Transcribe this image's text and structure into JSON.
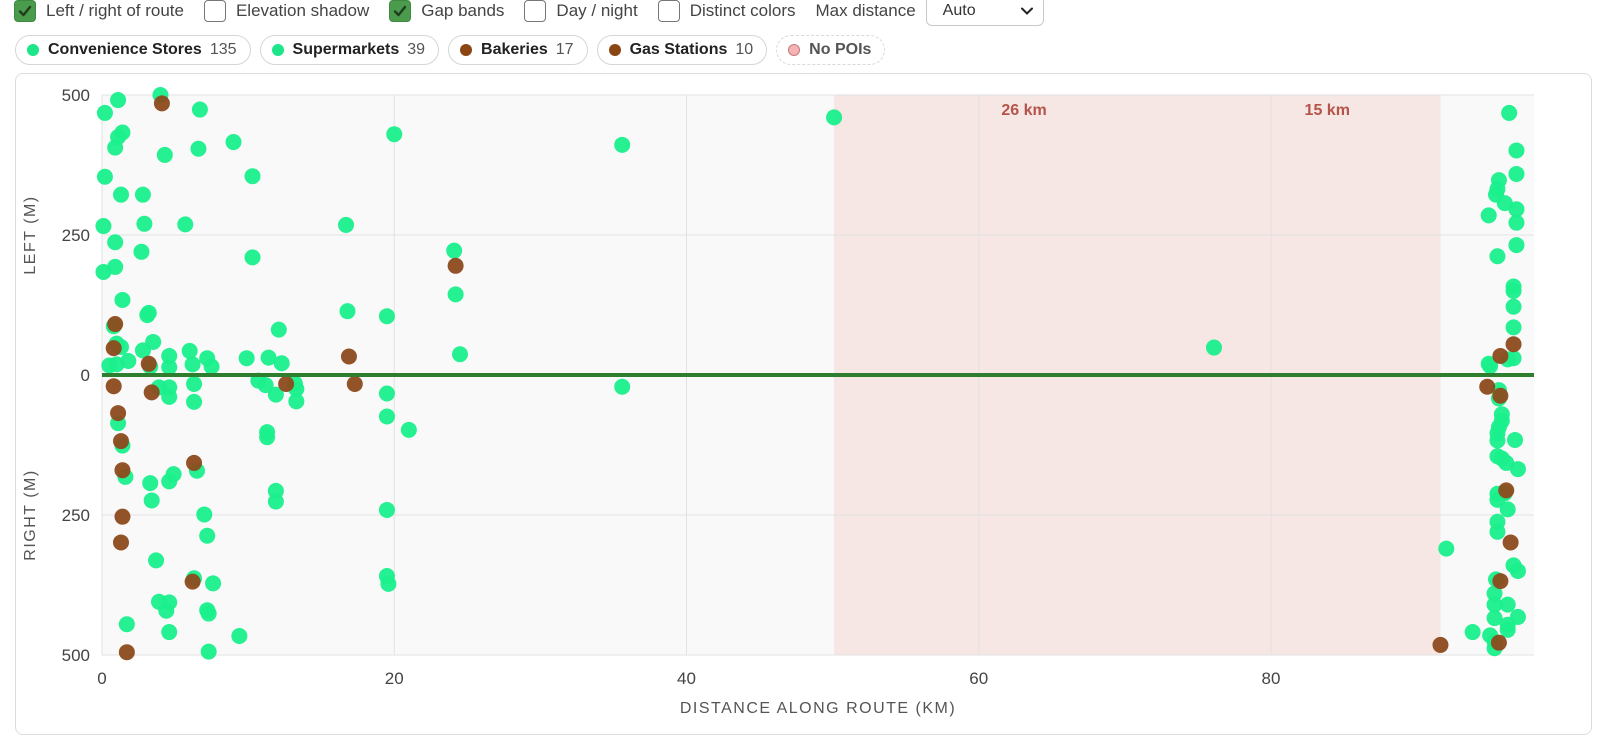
{
  "toolbar": {
    "checkboxes": [
      {
        "label": "Left / right of route",
        "checked": true
      },
      {
        "label": "Elevation shadow",
        "checked": false
      },
      {
        "label": "Gap bands",
        "checked": true
      },
      {
        "label": "Day / night",
        "checked": false
      },
      {
        "label": "Distinct colors",
        "checked": false
      }
    ],
    "max_distance_label": "Max distance",
    "max_distance_value": "Auto"
  },
  "legend_chips": [
    {
      "name": "Convenience Stores",
      "count": "135",
      "color": "#1de589"
    },
    {
      "name": "Supermarkets",
      "count": "39",
      "color": "#1de589"
    },
    {
      "name": "Bakeries",
      "count": "17",
      "color": "#8b4513"
    },
    {
      "name": "Gas Stations",
      "count": "10",
      "color": "#8b4513"
    },
    {
      "name": "No POIs",
      "color": "#f4b4b4"
    }
  ],
  "colors": {
    "poi_green": "#19ef8c",
    "poi_brown": "#8d4a1c",
    "route_line": "#2f7d2f",
    "gap_band": "#f6e6e4",
    "gap_label": "#b5544a",
    "plot_bg": "#f9f9f9",
    "grid": "#e2e2e2"
  },
  "chart_data": {
    "type": "scatter",
    "xlabel": "DISTANCE ALONG ROUTE (KM)",
    "ylabel_left": "LEFT (M)",
    "ylabel_right": "RIGHT (M)",
    "xlim": [
      0,
      98
    ],
    "ylim": [
      -500,
      500
    ],
    "x_ticks": [
      "0",
      "20",
      "40",
      "60",
      "80"
    ],
    "x_tick_values": [
      0,
      20,
      40,
      60,
      80
    ],
    "y_ticks": [
      "500",
      "250",
      "0",
      "250",
      "500"
    ],
    "y_tick_values": [
      500,
      250,
      0,
      -250,
      -500
    ],
    "grid": true,
    "route_line_y": 0,
    "gap_bands": [
      {
        "x0": 50.1,
        "x1": 76.1,
        "label": "26 km"
      },
      {
        "x0": 76.1,
        "x1": 91.6,
        "label": "15 km"
      }
    ],
    "series": [
      {
        "name": "Convenience Stores / Supermarkets",
        "color": "#19ef8c",
        "points": [
          [
            0.2,
            468
          ],
          [
            1.1,
            491
          ],
          [
            0.2,
            354
          ],
          [
            1.4,
            433
          ],
          [
            0.9,
            406
          ],
          [
            1.1,
            425
          ],
          [
            4.0,
            500
          ],
          [
            6.7,
            474
          ],
          [
            4.3,
            393
          ],
          [
            6.6,
            404
          ],
          [
            9.0,
            416
          ],
          [
            10.3,
            355
          ],
          [
            1.3,
            322
          ],
          [
            2.8,
            322
          ],
          [
            0.1,
            266
          ],
          [
            0.9,
            237
          ],
          [
            2.9,
            270
          ],
          [
            5.7,
            269
          ],
          [
            2.7,
            220
          ],
          [
            10.3,
            210
          ],
          [
            0.9,
            193
          ],
          [
            0.1,
            184
          ],
          [
            1.4,
            134
          ],
          [
            3.2,
            111
          ],
          [
            3.1,
            107
          ],
          [
            0.8,
            87
          ],
          [
            1.0,
            56
          ],
          [
            1.3,
            50
          ],
          [
            0.5,
            17
          ],
          [
            1.0,
            19
          ],
          [
            1.8,
            25
          ],
          [
            2.8,
            44
          ],
          [
            3.5,
            59
          ],
          [
            3.3,
            15
          ],
          [
            4.6,
            34
          ],
          [
            4.6,
            14
          ],
          [
            6.0,
            43
          ],
          [
            6.2,
            19
          ],
          [
            7.2,
            30
          ],
          [
            7.5,
            15
          ],
          [
            9.9,
            30
          ],
          [
            11.4,
            31
          ],
          [
            12.1,
            81
          ],
          [
            12.3,
            21
          ],
          [
            10.7,
            -10
          ],
          [
            11.2,
            -18
          ],
          [
            11.9,
            -35
          ],
          [
            13.3,
            -25
          ],
          [
            13.2,
            -15
          ],
          [
            13.3,
            -47
          ],
          [
            6.3,
            -16
          ],
          [
            6.3,
            -48
          ],
          [
            4.6,
            -22
          ],
          [
            4.6,
            -39
          ],
          [
            3.9,
            -22
          ],
          [
            1.1,
            -86
          ],
          [
            1.4,
            -126
          ],
          [
            1.6,
            -182
          ],
          [
            3.3,
            -193
          ],
          [
            4.6,
            -190
          ],
          [
            4.9,
            -177
          ],
          [
            6.5,
            -171
          ],
          [
            3.4,
            -224
          ],
          [
            7.0,
            -249
          ],
          [
            7.2,
            -287
          ],
          [
            3.7,
            -331
          ],
          [
            6.3,
            -363
          ],
          [
            7.6,
            -372
          ],
          [
            3.9,
            -405
          ],
          [
            4.6,
            -406
          ],
          [
            4.4,
            -421
          ],
          [
            7.2,
            -420
          ],
          [
            7.3,
            -426
          ],
          [
            1.7,
            -445
          ],
          [
            4.6,
            -459
          ],
          [
            9.4,
            -466
          ],
          [
            7.3,
            -494
          ],
          [
            11.3,
            -102
          ],
          [
            11.3,
            -111
          ],
          [
            11.9,
            -207
          ],
          [
            11.9,
            -226
          ],
          [
            16.7,
            268
          ],
          [
            16.8,
            114
          ],
          [
            20.0,
            430
          ],
          [
            19.5,
            105
          ],
          [
            24.1,
            222
          ],
          [
            24.2,
            144
          ],
          [
            24.5,
            37
          ],
          [
            19.5,
            -33
          ],
          [
            19.5,
            -74
          ],
          [
            21.0,
            -98
          ],
          [
            19.5,
            -241
          ],
          [
            19.5,
            -359
          ],
          [
            19.6,
            -373
          ],
          [
            35.6,
            411
          ],
          [
            35.6,
            -21
          ],
          [
            50.1,
            460
          ],
          [
            76.1,
            49
          ],
          [
            96.3,
            468
          ],
          [
            96.8,
            401
          ],
          [
            96.8,
            359
          ],
          [
            95.6,
            348
          ],
          [
            95.5,
            332
          ],
          [
            95.4,
            322
          ],
          [
            96.0,
            307
          ],
          [
            96.8,
            296
          ],
          [
            96.8,
            272
          ],
          [
            96.8,
            232
          ],
          [
            94.9,
            285
          ],
          [
            95.5,
            212
          ],
          [
            96.6,
            158
          ],
          [
            96.6,
            150
          ],
          [
            96.6,
            122
          ],
          [
            96.6,
            85
          ],
          [
            96.6,
            30
          ],
          [
            96.2,
            28
          ],
          [
            94.9,
            20
          ],
          [
            95.0,
            16
          ],
          [
            95.6,
            -27
          ],
          [
            95.6,
            -42
          ],
          [
            95.8,
            -70
          ],
          [
            95.8,
            -82
          ],
          [
            95.6,
            -93
          ],
          [
            95.5,
            -104
          ],
          [
            95.5,
            -117
          ],
          [
            96.7,
            -116
          ],
          [
            95.5,
            -145
          ],
          [
            95.8,
            -149
          ],
          [
            96.1,
            -157
          ],
          [
            96.9,
            -168
          ],
          [
            95.5,
            -212
          ],
          [
            95.5,
            -223
          ],
          [
            96.0,
            -211
          ],
          [
            96.2,
            -240
          ],
          [
            95.5,
            -262
          ],
          [
            95.5,
            -280
          ],
          [
            96.6,
            -340
          ],
          [
            96.9,
            -350
          ],
          [
            95.4,
            -365
          ],
          [
            95.3,
            -390
          ],
          [
            95.3,
            -410
          ],
          [
            96.2,
            -410
          ],
          [
            95.3,
            -434
          ],
          [
            96.9,
            -432
          ],
          [
            96.2,
            -446
          ],
          [
            96.2,
            -455
          ],
          [
            95.3,
            -476
          ],
          [
            95.3,
            -488
          ],
          [
            92.0,
            -310
          ],
          [
            93.8,
            -459
          ],
          [
            95.0,
            -465
          ]
        ]
      },
      {
        "name": "Bakeries / Gas Stations",
        "color": "#8d4a1c",
        "points": [
          [
            4.1,
            485
          ],
          [
            0.9,
            91
          ],
          [
            0.8,
            48
          ],
          [
            3.2,
            20
          ],
          [
            0.8,
            -20
          ],
          [
            3.4,
            -31
          ],
          [
            1.1,
            -68
          ],
          [
            1.3,
            -118
          ],
          [
            1.4,
            -170
          ],
          [
            1.4,
            -253
          ],
          [
            1.3,
            -299
          ],
          [
            6.3,
            -157
          ],
          [
            6.2,
            -369
          ],
          [
            1.7,
            -495
          ],
          [
            12.6,
            -16
          ],
          [
            16.9,
            33
          ],
          [
            17.3,
            -16
          ],
          [
            24.2,
            195
          ],
          [
            91.6,
            -482
          ],
          [
            94.8,
            -21
          ],
          [
            95.7,
            34
          ],
          [
            96.6,
            55
          ],
          [
            95.7,
            -37
          ],
          [
            95.7,
            -368
          ],
          [
            96.1,
            -206
          ],
          [
            96.4,
            -299
          ],
          [
            95.6,
            -478
          ]
        ]
      }
    ]
  }
}
